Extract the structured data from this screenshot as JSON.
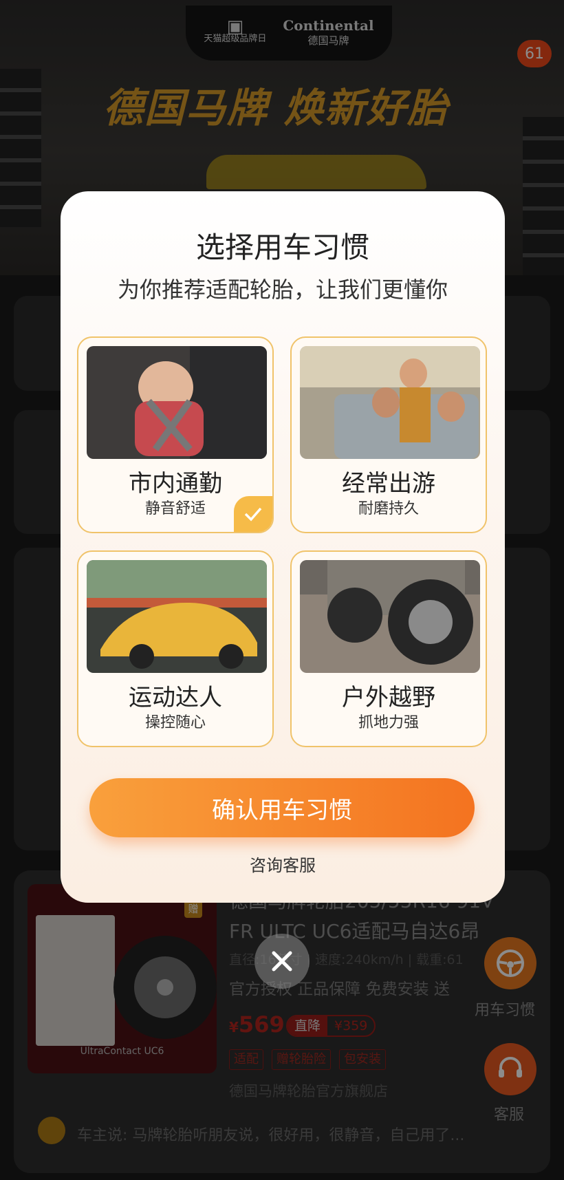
{
  "banner": {
    "tmall_logo_text": "天猫超级品牌日",
    "brand_name": "Continental",
    "brand_cn": "德国马牌",
    "slogan": "德国马牌 焕新好胎",
    "badge_count": "61"
  },
  "product": {
    "title": "德国马牌轮胎205/55R16 91V FR ULTC UC6适配马自达6昂",
    "spec": "直径:16英寸 | 速度:240km/h | 载重:61",
    "tags": "官方授权 正品保障 免费安装 送",
    "price_symbol": "¥",
    "price": "569",
    "discount_label": "直降",
    "discount_value": "¥359",
    "chips": [
      "适配",
      "赠轮胎险",
      "包安装"
    ],
    "shop": "德国马牌轮胎官方旗舰店",
    "thumb_label": "UltraContact UC6",
    "gift": "赠",
    "review": "车主说: 马牌轮胎听朋友说，很好用，很静音，自己用了..."
  },
  "fab": {
    "habit_label": "用车习惯",
    "service_label": "客服"
  },
  "modal": {
    "title": "选择用车习惯",
    "subtitle": "为你推荐适配轮胎，让我们更懂你",
    "options": [
      {
        "title": "市内通勤",
        "subtitle": "静音舒适",
        "selected": true
      },
      {
        "title": "经常出游",
        "subtitle": "耐磨持久",
        "selected": false
      },
      {
        "title": "运动达人",
        "subtitle": "操控随心",
        "selected": false
      },
      {
        "title": "户外越野",
        "subtitle": "抓地力强",
        "selected": false
      }
    ],
    "confirm_label": "确认用车习惯",
    "service_label": "咨询客服"
  },
  "colors": {
    "accent_orange": "#f47320",
    "option_border": "#f0c36a",
    "check_bg": "#f6bb48"
  }
}
